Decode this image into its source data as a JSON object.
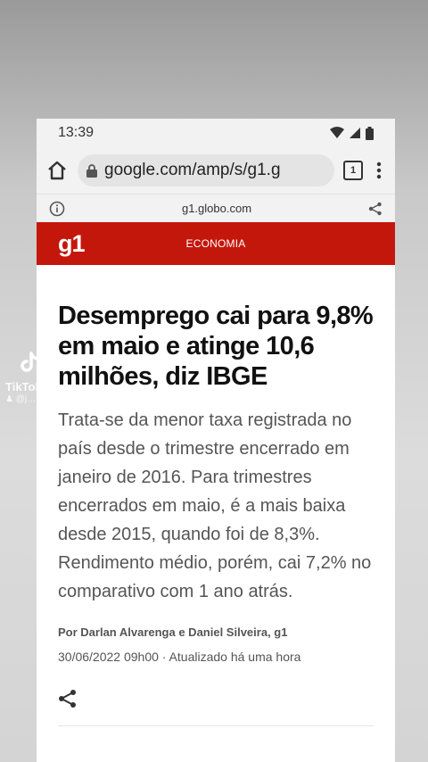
{
  "watermark": {
    "brand": "TikTok",
    "user": "@j…"
  },
  "status_bar": {
    "time": "13:39",
    "icons": [
      "wifi-icon",
      "signal-icon",
      "battery-icon"
    ]
  },
  "browser": {
    "url": "google.com/amp/s/g1.g",
    "tab_count": "1",
    "amp_domain": "g1.globo.com"
  },
  "site": {
    "logo": "g1",
    "section": "ECONOMIA",
    "brand_color": "#c4170c"
  },
  "article": {
    "headline": "Desemprego cai para 9,8% em maio e atinge 10,6 milhões, diz IBGE",
    "subhead": "Trata-se da menor taxa registrada no país desde o trimestre encerrado em janeiro de 2016. Para trimestres encerrados em maio, é a mais baixa desde 2015, quando foi de 8,3%. Rendimento médio, porém, cai 7,2% no comparativo com 1 ano atrás.",
    "byline": "Por Darlan Alvarenga e Daniel Silveira, g1",
    "dateline": "30/06/2022 09h00 · Atualizado há uma hora"
  }
}
